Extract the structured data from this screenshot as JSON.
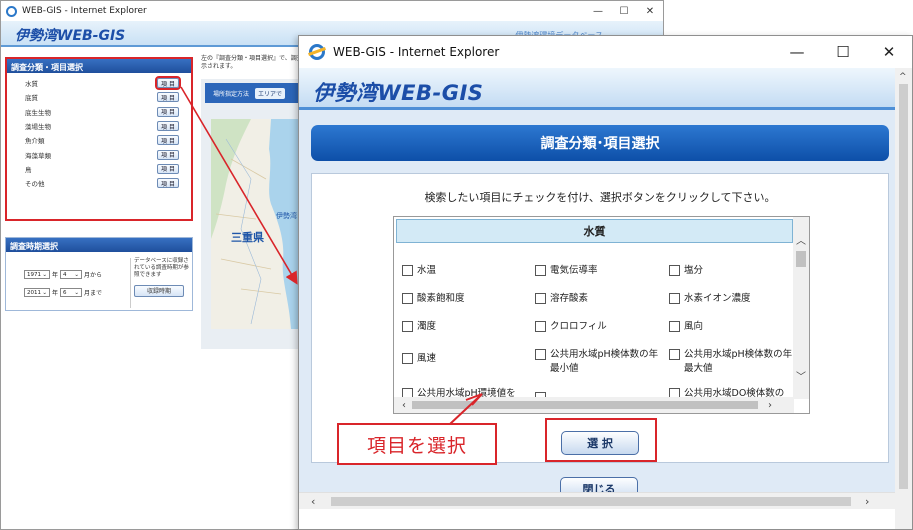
{
  "background_window": {
    "title": "WEB-GIS - Internet Explorer",
    "controls": [
      "—",
      "☐",
      "✕"
    ],
    "logo": "伊勢湾WEB-GIS",
    "subtitle": "伊勢湾環境データベース",
    "panel1_title": "調査分類・項目選択",
    "item_button_label": "項 目",
    "categories": [
      "水質",
      "底質",
      "底生生物",
      "藻場生物",
      "魚介類",
      "海藻草類",
      "鳥",
      "その他"
    ],
    "panel2_title": "調査時期選択",
    "start_year": "1971",
    "start_month": "4",
    "start_suffix": "月から",
    "end_year": "2011",
    "end_month": "6",
    "end_suffix": "月まで",
    "year_unit": "年",
    "note": "データベースに収録されている調査時期が参照できます",
    "period_button": "収録時期",
    "description": "左の『調査分類・項目選択』で、調査表示されます。",
    "map_bar_label": "場所指定方法",
    "map_bar_button": "エリアで",
    "map_label_prefecture": "三重県",
    "map_label_bay": "伊勢湾"
  },
  "popup": {
    "title": "WEB-GIS - Internet Explorer",
    "controls": [
      "—",
      "☐",
      "✕"
    ],
    "logo": "伊勢湾WEB-GIS",
    "banner": "調査分類･項目選択",
    "instruction": "検索したい項目にチェックを付け、選択ボタンをクリックして下さい。",
    "list_header": "水質",
    "items": [
      "水温",
      "電気伝導率",
      "塩分",
      "酸素飽和度",
      "溶存酸素",
      "水素イオン濃度",
      "濁度",
      "クロロフィル",
      "風向",
      "風速",
      "公共用水域pH検体数の年最小値",
      "公共用水域pH検体数の年最大値",
      "公共用水域pH環境値を",
      "",
      "公共用水域DO検体数の"
    ],
    "select_button": "選 択",
    "close_button": "閉じる"
  },
  "annotation": {
    "callout": "項目を選択"
  },
  "colors": {
    "accent": "#1f56a8",
    "banner": "#1459b3",
    "annotation_red": "#d9252a",
    "list_header_bg": "#d3eaf6"
  }
}
